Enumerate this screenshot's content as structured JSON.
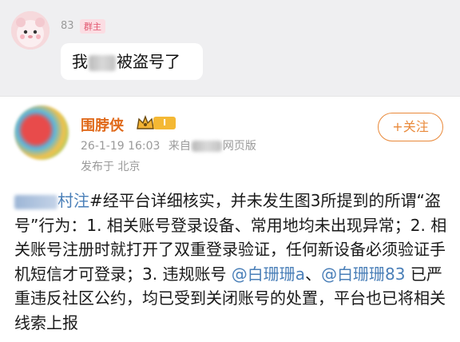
{
  "chat": {
    "sender_name": "83",
    "sender_badge": "群主",
    "message_prefix": "我",
    "message_suffix": "被盗号了"
  },
  "post": {
    "author": "围脖侠",
    "level": "I",
    "follow_label": "+关注",
    "timestamp": "26-1-19 16:03",
    "source_prefix": "来自",
    "source_suffix": "网页版",
    "location": "发布于 北京",
    "body": {
      "hashtag_tail": "村注",
      "text_1": "#经平台详细核实，并未发生图3所提到的所谓“盗号”行为：1. 相关账号登录设备、常用地均未出现异常；2. 相关账号注册时就打开了双重登录验证，任何新设备必须验证手机短信才可登录；3. 违规账号 ",
      "mention_1": "@白珊珊a",
      "sep": "、",
      "mention_2": "@白珊珊83",
      "text_2": " 已严重违反社区公约，均已受到关闭账号的处置，平台也已将相关线索上报"
    }
  },
  "colors": {
    "accent": "#e9893a",
    "author": "#e06a1b",
    "link": "#4a7fb8",
    "badge": "#e2566f"
  }
}
